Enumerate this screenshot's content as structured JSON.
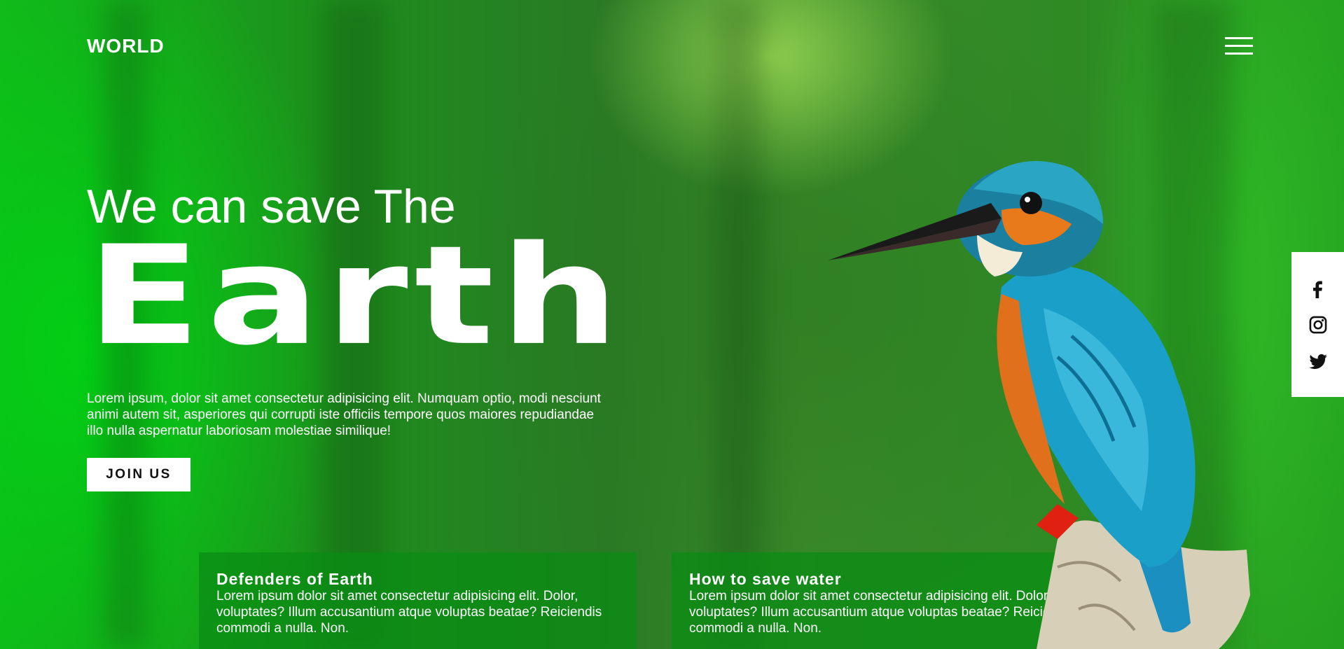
{
  "nav": {
    "logo": "WORLD",
    "menu_icon": "hamburger-menu-icon"
  },
  "hero": {
    "subtitle": "We can save The",
    "title": "Earth",
    "description": "Lorem ipsum, dolor sit amet consectetur adipisicing elit. Numquam optio, modi nesciunt animi autem sit, asperiores qui corrupti iste officiis tempore quos maiores repudiandae illo nulla aspernatur laboriosam molestiae similique!",
    "cta_label": "JOIN US"
  },
  "cards": [
    {
      "title": "Defenders of Earth",
      "text": "Lorem ipsum dolor sit amet consectetur adipisicing elit. Dolor, voluptates? Illum accusantium atque voluptas beatae? Reiciendis commodi a nulla. Non."
    },
    {
      "title": "How to save water",
      "text": "Lorem ipsum dolor sit amet consectetur adipisicing elit. Dolor, voluptates? Illum accusantium atque voluptas beatae? Reiciendis commodi a nulla. Non."
    }
  ],
  "social": [
    "facebook-icon",
    "instagram-icon",
    "twitter-icon"
  ],
  "colors": {
    "background": "#1f9a1f",
    "text": "#ffffff",
    "card_bg": "#0a8c14",
    "bird_teal": "#1aa0c8",
    "bird_orange": "#e0701c"
  }
}
